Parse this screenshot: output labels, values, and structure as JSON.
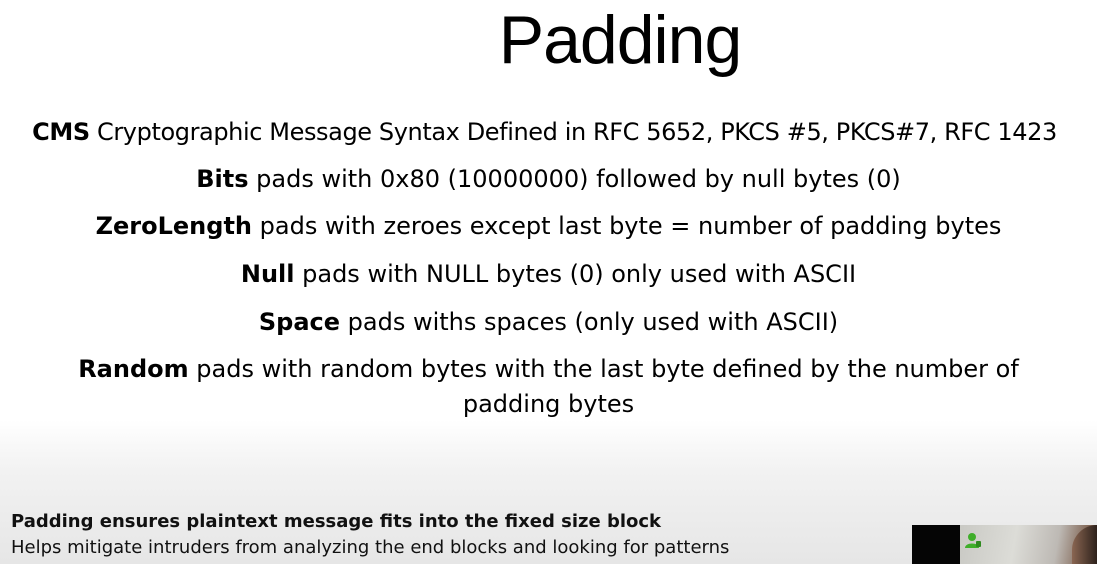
{
  "slide": {
    "title": "Padding",
    "definitions": [
      {
        "term": "CMS",
        "text": " Cryptographic Message Syntax Defined in RFC 5652, PKCS #5, PKCS#7, RFC 1423"
      },
      {
        "term": "Bits",
        "text": " pads with 0x80 (10000000) followed by null bytes (0)"
      },
      {
        "term": "ZeroLength",
        "text": " pads with zeroes except last byte = number of padding bytes"
      },
      {
        "term": "Null",
        "text": " pads with NULL bytes (0) only used with ASCII"
      },
      {
        "term": "Space",
        "text": " pads withs spaces (only used with ASCII)"
      },
      {
        "term": "Random",
        "text": " pads with random bytes with the last byte defined by the number of",
        "text_cont": "padding bytes"
      }
    ],
    "footer": {
      "line1": "Padding ensures plaintext message fits into the fixed size block",
      "line2": "Helps mitigate intruders from analyzing the end blocks and looking for patterns"
    }
  },
  "webcam": {
    "indicator_icon": "user-speaking-icon",
    "indicator_color": "#3fae2a"
  }
}
